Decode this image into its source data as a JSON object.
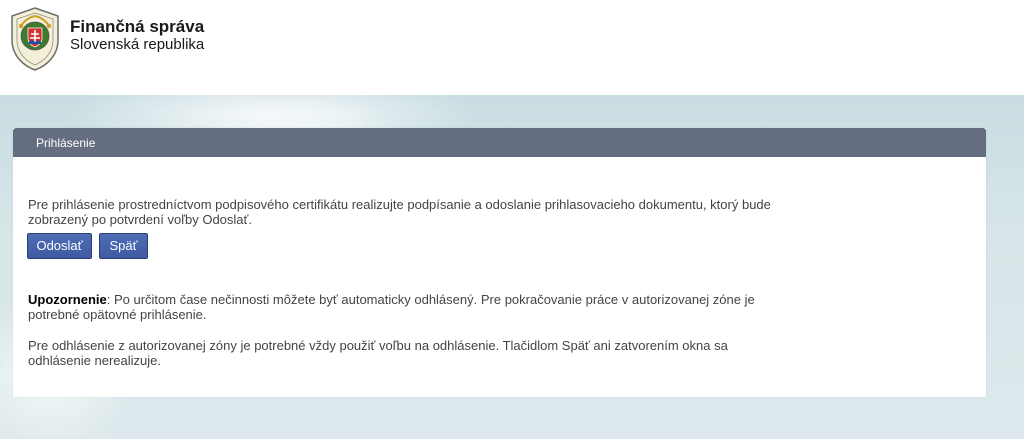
{
  "header": {
    "org_name": "Finančná správa",
    "org_sub": "Slovenská republika",
    "logo_icon": "coat-of-arms-icon"
  },
  "panel": {
    "title": "Prihlásenie",
    "paragraph1": "Pre prihlásenie prostredníctvom podpisového certifikátu realizujte podpísanie a odoslanie prihlasovacieho dokumentu, ktorý bude zobrazený po potvrdení voľby Odoslať.",
    "buttons": {
      "send_label": "Odoslať",
      "back_label": "Späť"
    },
    "warning_label": "Upozornenie",
    "warning_text": ": Po určitom čase nečinnosti môžete byť automaticky odhlásený. Pre pokračovanie práce v autorizovanej zóne je potrebné opätovné prihlásenie.",
    "paragraph3": "Pre odhlásenie z autorizovanej zóny je potrebné vždy použiť voľbu na odhlásenie. Tlačidlom Späť ani zatvorením okna sa odhlásenie nerealizuje."
  },
  "colors": {
    "panel_header": "#656e80",
    "button": "#4a64ad",
    "background_band": "#d3e3e7"
  }
}
